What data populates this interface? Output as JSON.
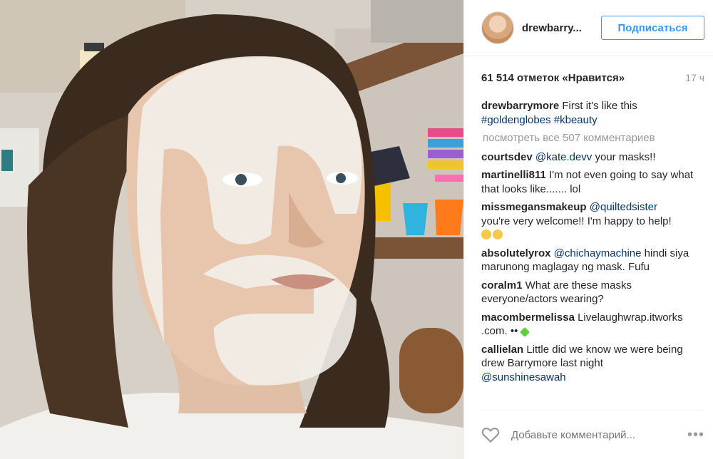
{
  "header": {
    "username": "drewbarry...",
    "follow_label": "Подписаться"
  },
  "meta": {
    "likes": "61 514 отметок «Нравится»",
    "timeago": "17 ч"
  },
  "caption": {
    "user": "drewbarrymore",
    "text": "First it's like this",
    "tags": "#goldenglobes #kbeauty"
  },
  "view_all": "посмотреть все 507 комментариев",
  "comments": [
    {
      "user": "courtsdev",
      "mention": "@kate.devv",
      "text": "your masks!!"
    },
    {
      "user": "martinelli811",
      "text": "I'm not even going to say what that looks like....... lol"
    },
    {
      "user": "missmegansmakeup",
      "mention": "@quiltedsister",
      "text": "you're very welcome!! I'm happy to help!"
    },
    {
      "user": "absolutelyrox",
      "mention": "@chichaymachine",
      "text": "hindi siya marunong maglagay ng mask. Fufu"
    },
    {
      "user": "coralm1",
      "text": "What are these masks everyone/actors wearing?"
    },
    {
      "user": "macombermelissa",
      "text": "Livelaughwrap.itworks .com. ••"
    },
    {
      "user": "callielan",
      "text": "Little did we know we were being drew Barrymore last night",
      "mention": "@sunshinesawah"
    }
  ],
  "add_comment_placeholder": "Добавьте комментарий...",
  "more_icon": "•••",
  "colors": {
    "accent": "#3897f0",
    "link": "#003569",
    "muted": "#999999"
  }
}
